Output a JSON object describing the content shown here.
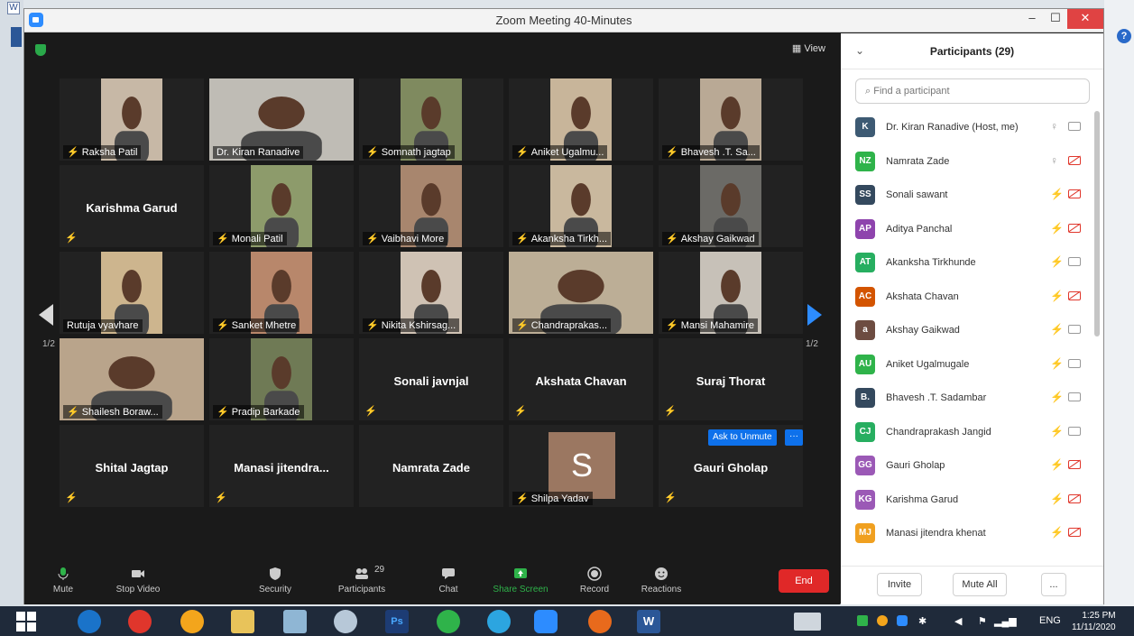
{
  "window": {
    "title": "Zoom Meeting 40-Minutes",
    "minimize": "–",
    "maximize": "☐",
    "close": "✕"
  },
  "video": {
    "view_label": "View",
    "page_left": "1/2",
    "page_right": "1/2",
    "tiles": [
      {
        "name": "Raksha Patil",
        "kind": "video",
        "photo": "#c7b8a6",
        "muted": true
      },
      {
        "name": "Dr. Kiran Ranadive",
        "kind": "video",
        "photo": "#bfbcb5",
        "muted": false,
        "active": true
      },
      {
        "name": "Somnath jagtap",
        "kind": "video",
        "photo": "#7f8a5f",
        "muted": true
      },
      {
        "name": "Aniket Ugalmu...",
        "kind": "video",
        "photo": "#c8b59a",
        "muted": true
      },
      {
        "name": "Bhavesh .T. Sa...",
        "kind": "video",
        "photo": "#b9a995",
        "muted": true
      },
      {
        "name": "Karishma Garud",
        "kind": "name",
        "muted": true
      },
      {
        "name": "Monali Patil",
        "kind": "video",
        "photo": "#8d9b6b",
        "muted": true
      },
      {
        "name": "Vaibhavi More",
        "kind": "video",
        "photo": "#a8866e",
        "muted": true
      },
      {
        "name": "Akanksha Tirkh...",
        "kind": "video",
        "photo": "#c9b89e",
        "muted": true
      },
      {
        "name": "Akshay Gaikwad",
        "kind": "video",
        "photo": "#6b6a66",
        "muted": true
      },
      {
        "name": "Rutuja vyavhare",
        "kind": "video",
        "photo": "#cdb58e",
        "muted": false
      },
      {
        "name": "Sanket Mhetre",
        "kind": "video",
        "photo": "#b8876b",
        "muted": true
      },
      {
        "name": "Nikita Kshirsag...",
        "kind": "video",
        "photo": "#cfc2b4",
        "muted": true
      },
      {
        "name": "Chandraprakas...",
        "kind": "video",
        "photo": "#bcae96",
        "muted": true
      },
      {
        "name": "Mansi Mahamire",
        "kind": "video",
        "photo": "#c7c1b8",
        "muted": true
      },
      {
        "name": "Shailesh Boraw...",
        "kind": "video",
        "photo": "#b9a48b",
        "muted": true
      },
      {
        "name": "Pradip Barkade",
        "kind": "video",
        "photo": "#6f7a55",
        "muted": true
      },
      {
        "name": "Sonali javnjal",
        "kind": "name",
        "muted": true
      },
      {
        "name": "Akshata Chavan",
        "kind": "name",
        "muted": true
      },
      {
        "name": "Suraj Thorat",
        "kind": "name",
        "muted": true
      },
      {
        "name": "Shital Jagtap",
        "kind": "name",
        "muted": true
      },
      {
        "name": "Manasi jitendra...",
        "kind": "name",
        "muted": true
      },
      {
        "name": "Namrata Zade",
        "kind": "name",
        "muted": false
      },
      {
        "name": "Shilpa Yadav",
        "kind": "avatar",
        "letter": "S",
        "muted": true
      },
      {
        "name": "Gauri Gholap",
        "kind": "name",
        "muted": true,
        "hover": true
      }
    ],
    "ask_to_unmute": "Ask to Unmute",
    "more_dots": "···"
  },
  "toolbar": {
    "mute": "Mute",
    "stop_video": "Stop Video",
    "security": "Security",
    "participants": "Participants",
    "participants_count": "29",
    "chat": "Chat",
    "share_screen": "Share Screen",
    "record": "Record",
    "reactions": "Reactions",
    "end": "End"
  },
  "panel": {
    "title": "Participants (29)",
    "search_placeholder": "Find a participant",
    "participants": [
      {
        "initials": "K",
        "name": "Dr. Kiran Ranadive (Host, me)",
        "color": "#3d5a73",
        "mic": "on",
        "cam": "on"
      },
      {
        "initials": "NZ",
        "name": "Namrata Zade",
        "color": "#2fb34a",
        "mic": "on",
        "cam": "off"
      },
      {
        "initials": "SS",
        "name": "Sonali sawant",
        "color": "#34495e",
        "mic": "off",
        "cam": "off"
      },
      {
        "initials": "AP",
        "name": "Aditya Panchal",
        "color": "#8e44ad",
        "mic": "off",
        "cam": "off"
      },
      {
        "initials": "AT",
        "name": "Akanksha Tirkhunde",
        "color": "#27ae60",
        "mic": "off",
        "cam": "on"
      },
      {
        "initials": "AC",
        "name": "Akshata Chavan",
        "color": "#d35400",
        "mic": "off",
        "cam": "off"
      },
      {
        "initials": "a",
        "name": "Akshay Gaikwad",
        "color": "#6d4c41",
        "mic": "off",
        "cam": "on"
      },
      {
        "initials": "AU",
        "name": "Aniket Ugalmugale",
        "color": "#2fb34a",
        "mic": "off",
        "cam": "on"
      },
      {
        "initials": "B.",
        "name": "Bhavesh .T. Sadambar",
        "color": "#34495e",
        "mic": "off",
        "cam": "on"
      },
      {
        "initials": "CJ",
        "name": "Chandraprakash Jangid",
        "color": "#27ae60",
        "mic": "off",
        "cam": "on"
      },
      {
        "initials": "GG",
        "name": "Gauri Gholap",
        "color": "#9b59b6",
        "mic": "off",
        "cam": "off"
      },
      {
        "initials": "KG",
        "name": "Karishma Garud",
        "color": "#9b59b6",
        "mic": "off",
        "cam": "off"
      },
      {
        "initials": "MJ",
        "name": "Manasi jitendra khenat",
        "color": "#f0a020",
        "mic": "off",
        "cam": "off"
      }
    ],
    "invite": "Invite",
    "mute_all": "Mute All",
    "more": "..."
  },
  "taskbar": {
    "language": "ENG",
    "time": "1:25 PM",
    "date": "11/11/2020",
    "word_label": "W",
    "ps_label": "Ps"
  },
  "colors": {
    "accent": "#2d8cff",
    "active_border": "#9ad33a",
    "muted": "#e0372c",
    "end": "#e02828"
  }
}
